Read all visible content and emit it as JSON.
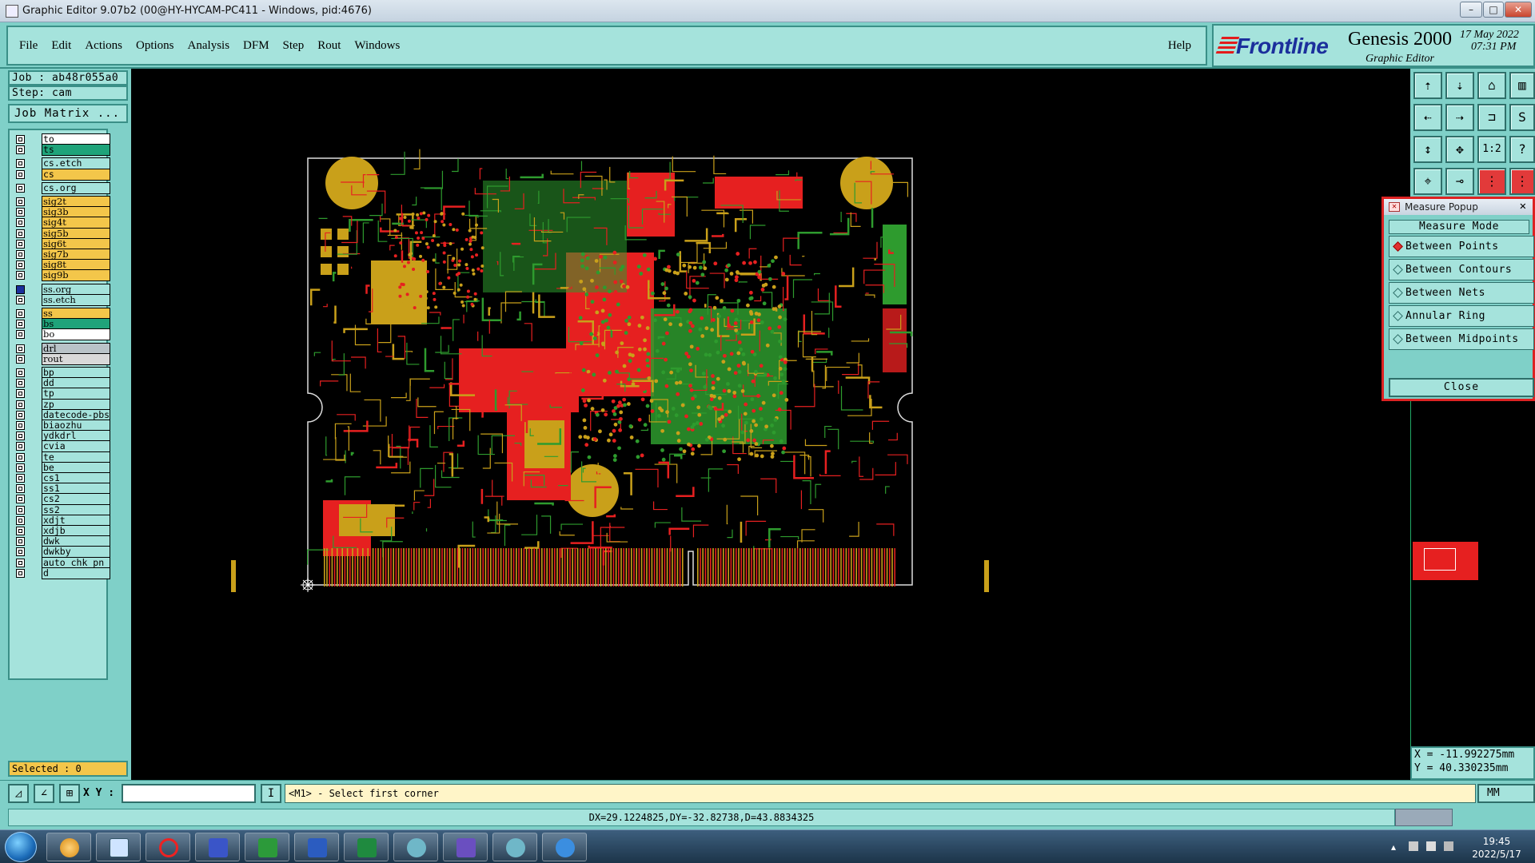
{
  "window": {
    "title": "Graphic Editor 9.07b2 (00@HY-HYCAM-PC411 - Windows, pid:4676)"
  },
  "menu": {
    "items": [
      "File",
      "Edit",
      "Actions",
      "Options",
      "Analysis",
      "DFM",
      "Step",
      "Rout",
      "Windows"
    ],
    "help": "Help"
  },
  "brand": {
    "logo": "Frontline",
    "product": "Genesis 2000",
    "subtitle": "Graphic Editor",
    "date": "17 May 2022",
    "time": "07:31 PM"
  },
  "job": {
    "job_line": "Job : ab48r055a0",
    "step_line": "Step: cam",
    "matrix_button": "Job Matrix ..."
  },
  "layers": [
    {
      "name": "to",
      "color": "#ffffff"
    },
    {
      "name": "ts",
      "color": "#1fa37a"
    },
    {
      "name": "cs.etch",
      "color": "#a5e3dc"
    },
    {
      "name": "cs",
      "color": "#f3c64a"
    },
    {
      "name": "cs.org",
      "color": "#a5e3dc"
    },
    {
      "name": "sig2t",
      "color": "#f3c64a"
    },
    {
      "name": "sig3b",
      "color": "#f3c64a"
    },
    {
      "name": "sig4t",
      "color": "#f3c64a"
    },
    {
      "name": "sig5b",
      "color": "#f3c64a"
    },
    {
      "name": "sig6t",
      "color": "#f3c64a"
    },
    {
      "name": "sig7b",
      "color": "#f3c64a"
    },
    {
      "name": "sig8t",
      "color": "#f3c64a"
    },
    {
      "name": "sig9b",
      "color": "#f3c64a"
    },
    {
      "name": "ss.org",
      "color": "#a5e3dc"
    },
    {
      "name": "ss.etch",
      "color": "#a5e3dc"
    },
    {
      "name": "ss",
      "color": "#f3c64a"
    },
    {
      "name": "bs",
      "color": "#1fa37a"
    },
    {
      "name": "bo",
      "color": "#ffffff"
    },
    {
      "name": "drl",
      "color": "#b9c3c8"
    },
    {
      "name": "rout",
      "color": "#d9d9d9"
    },
    {
      "name": "bp",
      "color": "#a5e3dc"
    },
    {
      "name": "dd",
      "color": "#a5e3dc"
    },
    {
      "name": "tp",
      "color": "#a5e3dc"
    },
    {
      "name": "zp",
      "color": "#a5e3dc"
    },
    {
      "name": "datecode-pbs",
      "color": "#a5e3dc"
    },
    {
      "name": "biaozhu",
      "color": "#a5e3dc"
    },
    {
      "name": "ydkdrl",
      "color": "#a5e3dc"
    },
    {
      "name": "cvia",
      "color": "#a5e3dc"
    },
    {
      "name": "te",
      "color": "#a5e3dc"
    },
    {
      "name": "be",
      "color": "#a5e3dc"
    },
    {
      "name": "cs1",
      "color": "#a5e3dc"
    },
    {
      "name": "ss1",
      "color": "#a5e3dc"
    },
    {
      "name": "cs2",
      "color": "#a5e3dc"
    },
    {
      "name": "ss2",
      "color": "#a5e3dc"
    },
    {
      "name": "xdjt",
      "color": "#a5e3dc"
    },
    {
      "name": "xdjb",
      "color": "#a5e3dc"
    },
    {
      "name": "dwk",
      "color": "#a5e3dc"
    },
    {
      "name": "dwkby",
      "color": "#a5e3dc"
    },
    {
      "name": "auto_chk_pn",
      "color": "#a5e3dc"
    },
    {
      "name": "d",
      "color": "#a5e3dc"
    }
  ],
  "selected": "Selected : 0",
  "measure": {
    "title": "Measure Popup",
    "mode_header": "Measure Mode",
    "options": [
      "Between Points",
      "Between Contours",
      "Between Nets",
      "Annular Ring",
      "Between Midpoints"
    ],
    "active_index": 0,
    "close": "Close"
  },
  "coords": {
    "x": "X = -11.992275mm",
    "y": "Y = 40.330235mm"
  },
  "status": {
    "xy_label": "X Y :",
    "xy_value": "",
    "prompt": "<M1> - Select first corner",
    "units": "MM",
    "measurement": "DX=29.1224825,DY=-32.82738,D=43.8834325"
  },
  "tray": {
    "time": "19:45",
    "date": "2022/5/17"
  },
  "colors": {
    "panel": "#7fd0c8",
    "field": "#a5e3dc",
    "copper_red": "#e62020",
    "copper_green": "#2e9b2e",
    "copper_gold": "#c9a01a"
  }
}
